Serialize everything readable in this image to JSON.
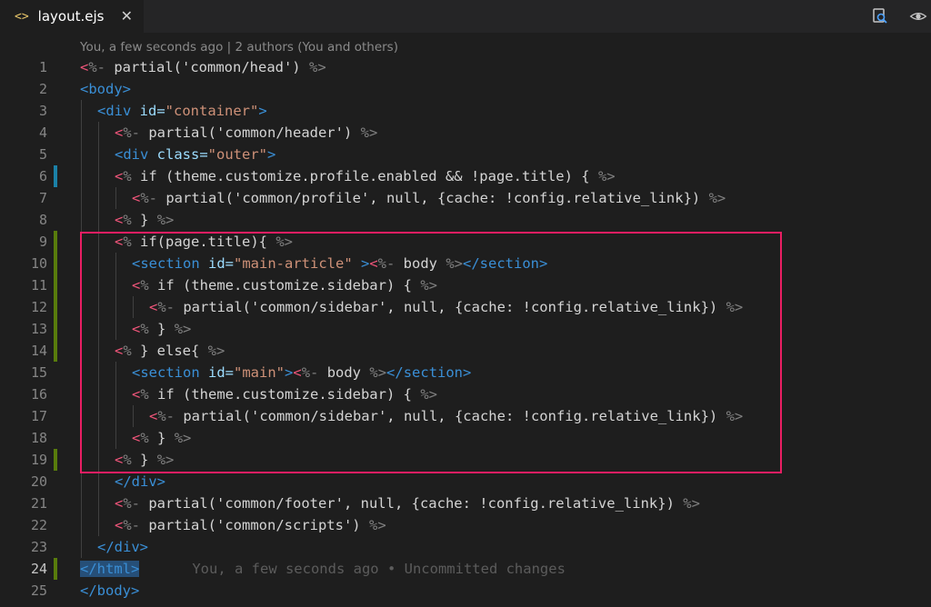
{
  "tab": {
    "filename": "layout.ejs",
    "icon": "<>",
    "close": "✕"
  },
  "blame_header": "You, a few seconds ago | 2 authors (You and others)",
  "inline_blame": "You, a few seconds ago • Uncommitted changes",
  "colors": {
    "accent_box": "#e91e63",
    "modified": "#1b81a8",
    "added": "#587c0c"
  },
  "line_numbers": [
    "1",
    "2",
    "3",
    "4",
    "5",
    "6",
    "7",
    "8",
    "9",
    "10",
    "11",
    "12",
    "13",
    "14",
    "15",
    "16",
    "17",
    "18",
    "19",
    "20",
    "21",
    "22",
    "23",
    "24",
    "25"
  ],
  "lines": [
    {
      "indent": 0,
      "gutter": "",
      "tokens": [
        [
          "lt",
          "<"
        ],
        [
          "pct",
          "%- "
        ],
        [
          "txt",
          "partial('common/head') "
        ],
        [
          "pct",
          "%>"
        ]
      ]
    },
    {
      "indent": 0,
      "gutter": "",
      "tokens": [
        [
          "tag",
          "<body>"
        ]
      ]
    },
    {
      "indent": 1,
      "gutter": "",
      "tokens": [
        [
          "tag",
          "<div "
        ],
        [
          "attr",
          "id="
        ],
        [
          "str",
          "\"container\""
        ],
        [
          "tag",
          ">"
        ]
      ]
    },
    {
      "indent": 2,
      "gutter": "",
      "tokens": [
        [
          "lt",
          "<"
        ],
        [
          "pct",
          "%- "
        ],
        [
          "txt",
          "partial('common/header') "
        ],
        [
          "pct",
          "%>"
        ]
      ]
    },
    {
      "indent": 2,
      "gutter": "",
      "tokens": [
        [
          "tag",
          "<div "
        ],
        [
          "attr",
          "class="
        ],
        [
          "str",
          "\"outer\""
        ],
        [
          "tag",
          ">"
        ]
      ]
    },
    {
      "indent": 2,
      "gutter": "mod",
      "tokens": [
        [
          "lt",
          "<"
        ],
        [
          "pct",
          "% "
        ],
        [
          "txt",
          "if (theme.customize.profile.enabled && !page.title) { "
        ],
        [
          "pct",
          "%>"
        ]
      ]
    },
    {
      "indent": 3,
      "gutter": "",
      "tokens": [
        [
          "lt",
          "<"
        ],
        [
          "pct",
          "%- "
        ],
        [
          "txt",
          "partial('common/profile', null, {cache: !config.relative_link}) "
        ],
        [
          "pct",
          "%>"
        ]
      ]
    },
    {
      "indent": 2,
      "gutter": "",
      "tokens": [
        [
          "lt",
          "<"
        ],
        [
          "pct",
          "% "
        ],
        [
          "txt",
          "} "
        ],
        [
          "pct",
          "%>"
        ]
      ]
    },
    {
      "indent": 2,
      "gutter": "add",
      "tokens": [
        [
          "lt",
          "<"
        ],
        [
          "pct",
          "% "
        ],
        [
          "txt",
          "if(page.title){ "
        ],
        [
          "pct",
          "%>"
        ]
      ]
    },
    {
      "indent": 3,
      "gutter": "add",
      "tokens": [
        [
          "tag",
          "<section "
        ],
        [
          "attr",
          "id="
        ],
        [
          "str",
          "\"main-article\""
        ],
        [
          "tag",
          " >"
        ],
        [
          "lt",
          "<"
        ],
        [
          "pct",
          "%- "
        ],
        [
          "txt",
          "body "
        ],
        [
          "pct",
          "%>"
        ],
        [
          "tag",
          "</section>"
        ]
      ]
    },
    {
      "indent": 3,
      "gutter": "add",
      "tokens": [
        [
          "lt",
          "<"
        ],
        [
          "pct",
          "% "
        ],
        [
          "txt",
          "if (theme.customize.sidebar) { "
        ],
        [
          "pct",
          "%>"
        ]
      ]
    },
    {
      "indent": 4,
      "gutter": "add",
      "tokens": [
        [
          "lt",
          "<"
        ],
        [
          "pct",
          "%- "
        ],
        [
          "txt",
          "partial('common/sidebar', null, {cache: !config.relative_link}) "
        ],
        [
          "pct",
          "%>"
        ]
      ]
    },
    {
      "indent": 3,
      "gutter": "add",
      "tokens": [
        [
          "lt",
          "<"
        ],
        [
          "pct",
          "% "
        ],
        [
          "txt",
          "} "
        ],
        [
          "pct",
          "%>"
        ]
      ]
    },
    {
      "indent": 2,
      "gutter": "add",
      "tokens": [
        [
          "lt",
          "<"
        ],
        [
          "pct",
          "% "
        ],
        [
          "txt",
          "} else{ "
        ],
        [
          "pct",
          "%>"
        ]
      ]
    },
    {
      "indent": 3,
      "gutter": "",
      "tokens": [
        [
          "tag",
          "<section "
        ],
        [
          "attr",
          "id="
        ],
        [
          "str",
          "\"main\""
        ],
        [
          "tag",
          ">"
        ],
        [
          "lt",
          "<"
        ],
        [
          "pct",
          "%- "
        ],
        [
          "txt",
          "body "
        ],
        [
          "pct",
          "%>"
        ],
        [
          "tag",
          "</section>"
        ]
      ]
    },
    {
      "indent": 3,
      "gutter": "",
      "tokens": [
        [
          "lt",
          "<"
        ],
        [
          "pct",
          "% "
        ],
        [
          "txt",
          "if (theme.customize.sidebar) { "
        ],
        [
          "pct",
          "%>"
        ]
      ]
    },
    {
      "indent": 4,
      "gutter": "",
      "tokens": [
        [
          "lt",
          "<"
        ],
        [
          "pct",
          "%- "
        ],
        [
          "txt",
          "partial('common/sidebar', null, {cache: !config.relative_link}) "
        ],
        [
          "pct",
          "%>"
        ]
      ]
    },
    {
      "indent": 3,
      "gutter": "",
      "tokens": [
        [
          "lt",
          "<"
        ],
        [
          "pct",
          "% "
        ],
        [
          "txt",
          "} "
        ],
        [
          "pct",
          "%>"
        ]
      ]
    },
    {
      "indent": 2,
      "gutter": "add",
      "tokens": [
        [
          "lt",
          "<"
        ],
        [
          "pct",
          "% "
        ],
        [
          "txt",
          "} "
        ],
        [
          "pct",
          "%>"
        ]
      ]
    },
    {
      "indent": 2,
      "gutter": "",
      "tokens": [
        [
          "tag",
          "</div>"
        ]
      ]
    },
    {
      "indent": 2,
      "gutter": "",
      "tokens": [
        [
          "lt",
          "<"
        ],
        [
          "pct",
          "%- "
        ],
        [
          "txt",
          "partial('common/footer', null, {cache: !config.relative_link}) "
        ],
        [
          "pct",
          "%>"
        ]
      ]
    },
    {
      "indent": 2,
      "gutter": "",
      "tokens": [
        [
          "lt",
          "<"
        ],
        [
          "pct",
          "%- "
        ],
        [
          "txt",
          "partial('common/scripts') "
        ],
        [
          "pct",
          "%>"
        ]
      ]
    },
    {
      "indent": 1,
      "gutter": "",
      "tokens": [
        [
          "tag",
          "</div>"
        ]
      ]
    },
    {
      "indent": 0,
      "gutter": "add",
      "selected": true,
      "blame": true,
      "tokens": [
        [
          "tag",
          "</html>"
        ]
      ]
    },
    {
      "indent": 0,
      "gutter": "",
      "tokens": [
        [
          "tag",
          "</body>"
        ]
      ]
    }
  ]
}
